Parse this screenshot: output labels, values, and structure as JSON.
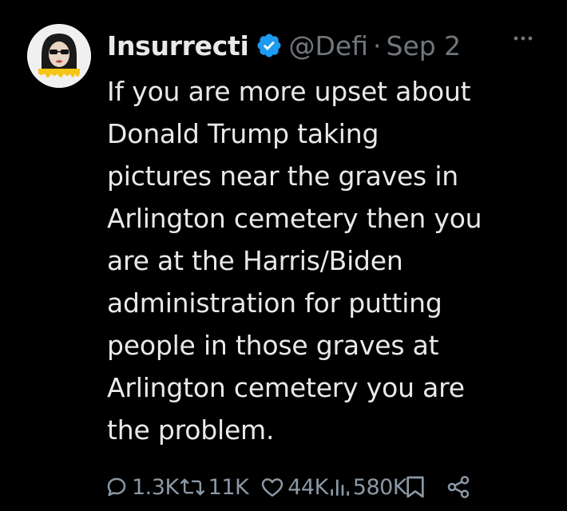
{
  "tweet": {
    "author": {
      "display_name": "Insurrecti",
      "handle": "@Defi",
      "verified": true,
      "avatar_icon": "avatar-woman-sunglasses"
    },
    "separator": "·",
    "timestamp": "Sep 2",
    "more_icon": "more-horizontal-icon",
    "body_lines": [
      "If you are more upset about",
      "Donald Trump taking",
      "pictures near the graves in",
      "Arlington cemetery then you",
      "are at the Harris/Biden",
      "administration for putting",
      "people in those graves at",
      "Arlington cemetery you are",
      "the problem."
    ],
    "actions": {
      "reply_count": "1.3K",
      "retweet_count": "11K",
      "like_count": "44K",
      "view_count": "580K"
    }
  },
  "colors": {
    "background": "#000000",
    "text_primary": "#e7e9ea",
    "text_secondary": "#71767b",
    "verified_blue": "#1d9bf0",
    "avatar_accent": "#f5c518"
  }
}
